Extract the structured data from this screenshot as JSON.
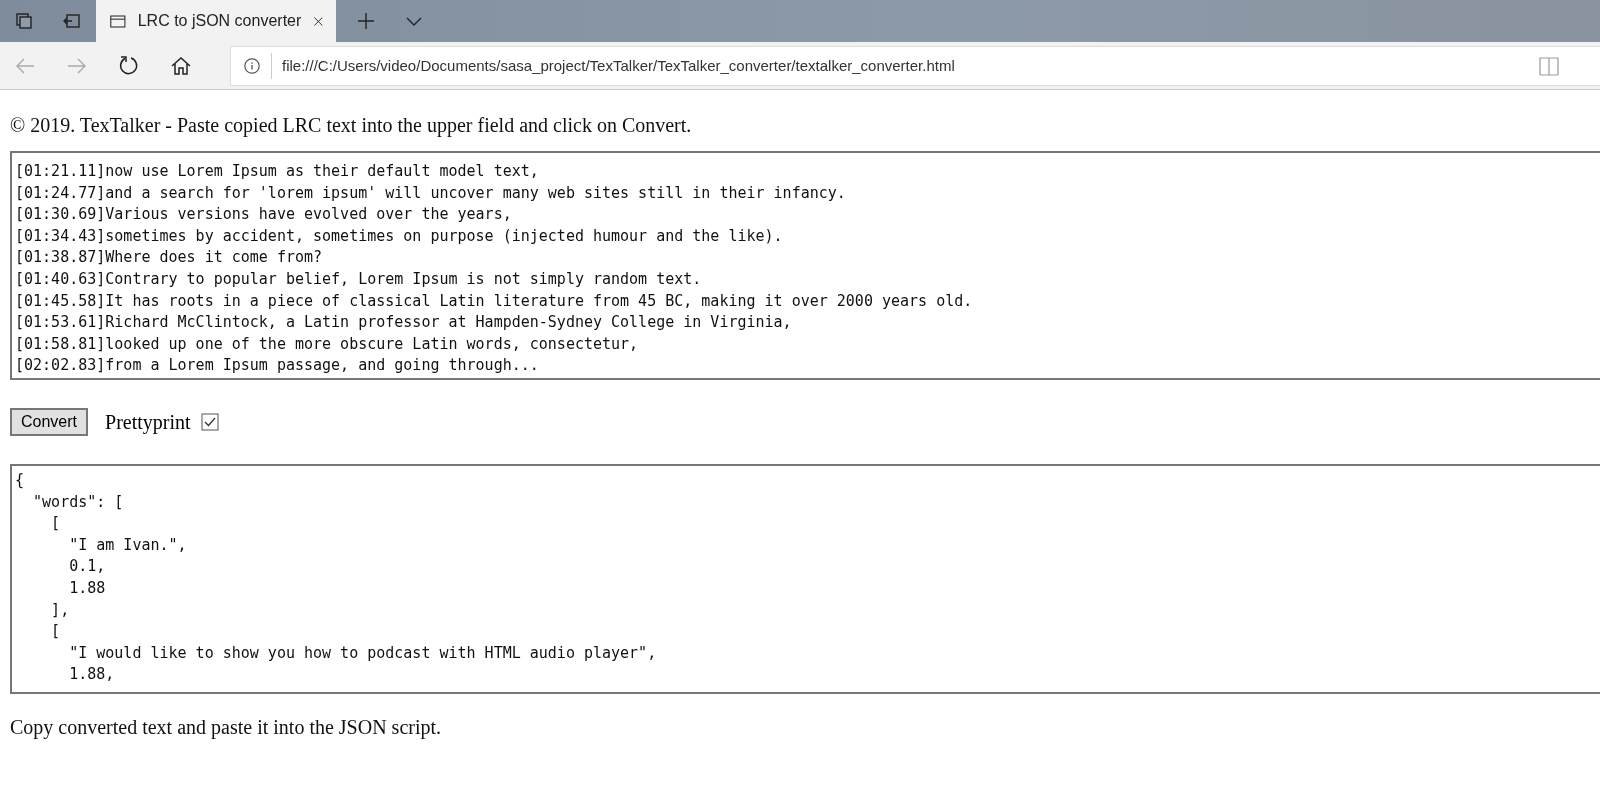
{
  "browser": {
    "tab": {
      "title": "LRC to jSON converter",
      "selected": true
    },
    "address": "file:///C:/Users/video/Documents/sasa_project/TexTalker/TexTalker_converter/textalker_converter.html"
  },
  "page": {
    "header": "© 2019. TexTalker - Paste copied LRC text into the upper field and click on Convert.",
    "lrc_input": {
      "lines": [
        "[01:21.11]now use Lorem Ipsum as their default model text,",
        "[01:24.77]and a search for 'lorem ipsum' will uncover many web sites still in their infancy.",
        "[01:30.69]Various versions have evolved over the years,",
        "[01:34.43]sometimes by accident, sometimes on purpose (injected humour and the like).",
        "[01:38.87]Where does it come from?",
        "[01:40.63]Contrary to popular belief, Lorem Ipsum is not simply random text.",
        "[01:45.58]It has roots in a piece of classical Latin literature from 45 BC, making it over 2000 years old.",
        "[01:53.61]Richard McClintock, a Latin professor at Hampden-Sydney College in Virginia,",
        "[01:58.81]looked up one of the more obscure Latin words, consectetur,",
        "[02:02.83]from a Lorem Ipsum passage, and going through..."
      ]
    },
    "convert_button": "Convert",
    "prettyprint": {
      "label": "Prettyprint",
      "checked": true
    },
    "json_output": {
      "lines": [
        "{",
        "  \"words\": [",
        "    [",
        "      \"I am Ivan.\",",
        "      0.1,",
        "      1.88",
        "    ],",
        "    [",
        "      \"I would like to show you how to podcast with HTML audio player\",",
        "      1.88,"
      ]
    },
    "footer": "Copy converted text and paste it into the JSON script."
  }
}
